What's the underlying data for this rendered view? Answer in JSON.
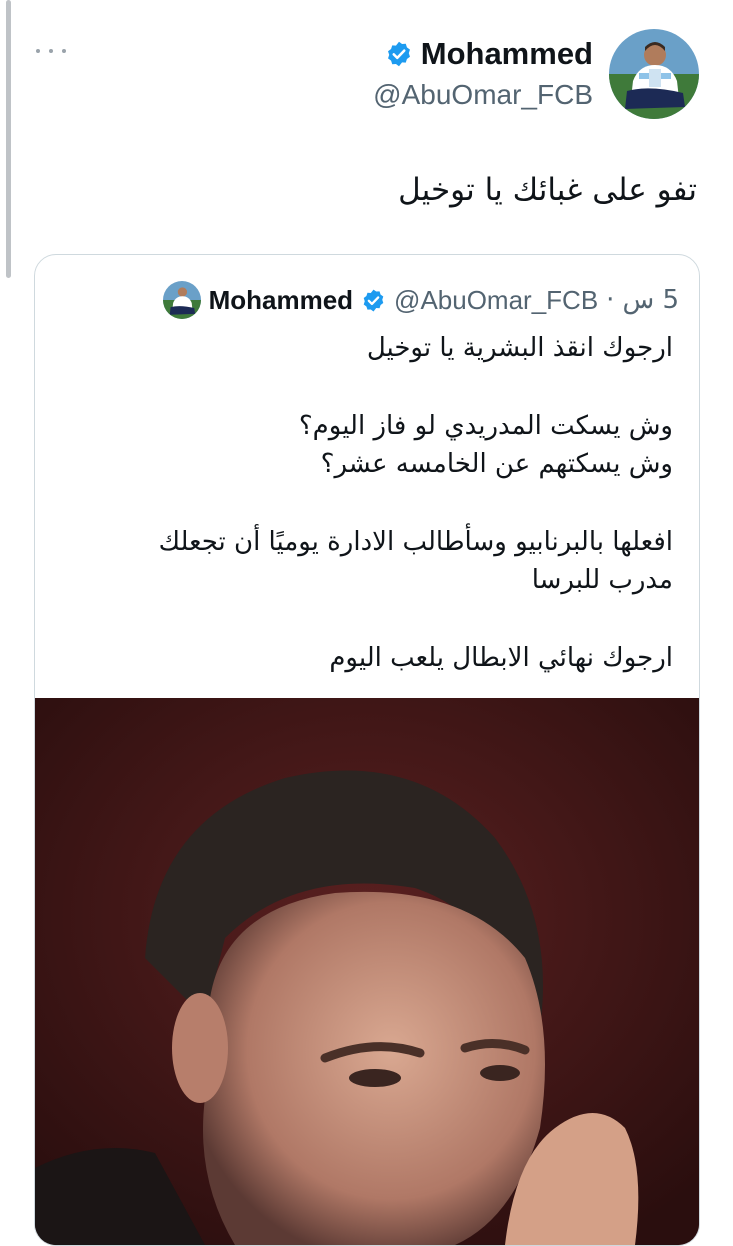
{
  "tweet": {
    "author": {
      "display_name": "Mohammed",
      "handle": "@AbuOmar_FCB",
      "verified": true,
      "avatar_icon": "player-avatar"
    },
    "more_icon": "more-horizontal-icon",
    "text": "تفو على غبائك يا توخيل"
  },
  "quoted_tweet": {
    "author": {
      "display_name": "Mohammed",
      "handle": "@AbuOmar_FCB",
      "verified": true
    },
    "time": "5 س",
    "separator": "·",
    "lines": [
      "ارجوك انقذ البشرية يا توخيل",
      "",
      "وش يسكت المدريدي لو فاز اليوم؟",
      "وش يسكتهم عن الخامسه عشر؟",
      "",
      "افعلها بالبرنابيو وسأطالب الادارة يوميًا أن تجعلك",
      "مدرب للبرسا",
      "",
      "ارجوك نهائي الابطال يلعب اليوم"
    ],
    "media": {
      "type": "photo",
      "background_color": "#3a1515"
    }
  },
  "colors": {
    "verified_blue": "#1d9bf0",
    "secondary_text": "#536471",
    "border": "#cfd9de"
  }
}
